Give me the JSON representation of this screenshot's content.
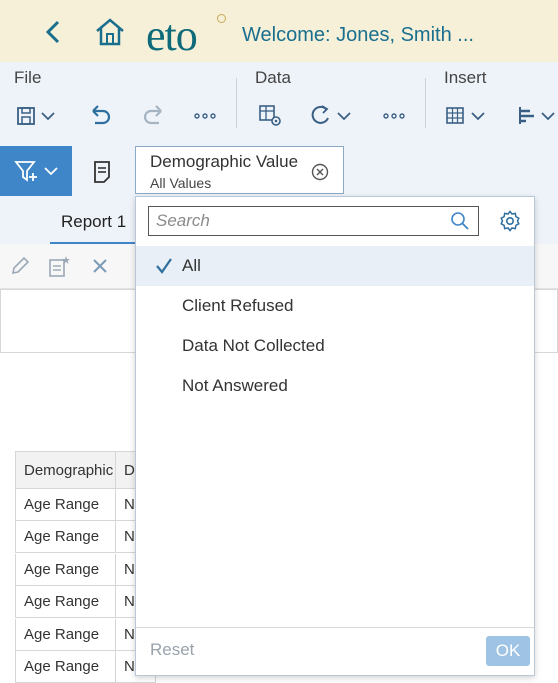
{
  "header": {
    "logo": "eto",
    "welcome": "Welcome: Jones, Smith ..."
  },
  "toolbar": {
    "groups": [
      "File",
      "Data",
      "Insert"
    ],
    "more_label": "∘∘∘"
  },
  "filter": {
    "chip_title": "Demographic Value",
    "chip_value": "All Values"
  },
  "tabs": [
    {
      "label": "Report 1"
    }
  ],
  "table": {
    "headers": [
      "Demographic",
      "D"
    ],
    "rows": [
      [
        "Age Range",
        "N"
      ],
      [
        "Age Range",
        "N"
      ],
      [
        "Age Range",
        "N"
      ],
      [
        "Age Range",
        "N"
      ],
      [
        "Age Range",
        "N"
      ],
      [
        "Age Range",
        "N"
      ]
    ]
  },
  "dropdown": {
    "search_placeholder": "Search",
    "options": [
      {
        "label": "All",
        "selected": true
      },
      {
        "label": "Client Refused",
        "selected": false
      },
      {
        "label": "Data Not Collected",
        "selected": false
      },
      {
        "label": "Not Answered",
        "selected": false
      }
    ],
    "reset_label": "Reset",
    "ok_label": "OK"
  },
  "colors": {
    "header_bg": "#f6f0d8",
    "brand_teal": "#0f6b7a",
    "accent_blue": "#3f86c9",
    "toolbar_bg": "#eef3f9"
  }
}
